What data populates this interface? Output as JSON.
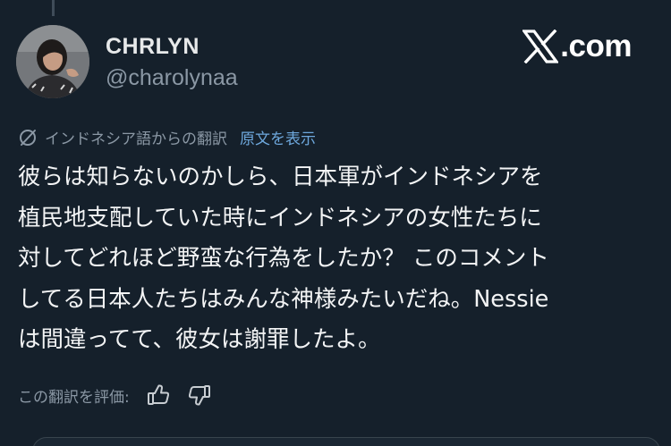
{
  "author": {
    "name": "CHRLYN",
    "handle": "@charolynaa"
  },
  "site": {
    "logo_text": ".com",
    "logo_icon": "x-logo-icon"
  },
  "translation": {
    "label": "インドネシア語からの翻訳",
    "show_original": "原文を表示"
  },
  "post": {
    "text": "彼らは知らないのかしら、日本軍がインドネシアを\n植民地支配していた時にインドネシアの女性たちに\n対してどれほど野蛮な行為をしたか？ このコメント\nしてる日本人たちはみんな神様みたいだね。Nessie\nは間違ってて、彼女は謝罪したよ。"
  },
  "rating": {
    "label": "この翻訳を評価:",
    "up_icon": "thumbs-up-icon",
    "down_icon": "thumbs-down-icon"
  },
  "colors": {
    "background": "#15202b",
    "link": "#6ea8dd",
    "muted": "#8b98a5"
  }
}
